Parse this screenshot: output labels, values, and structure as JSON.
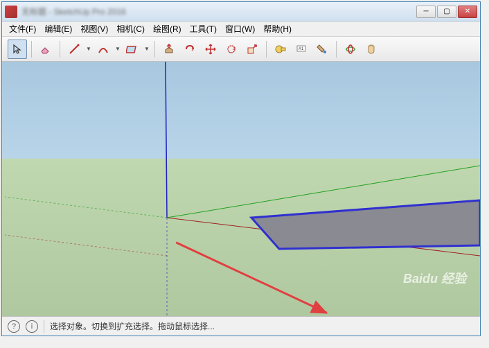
{
  "window": {
    "title": "无标题 - SketchUp Pro 2016"
  },
  "menu": {
    "file": "文件(F)",
    "edit": "编辑(E)",
    "view": "视图(V)",
    "camera": "相机(C)",
    "draw": "绘图(R)",
    "tools": "工具(T)",
    "window": "窗口(W)",
    "help": "帮助(H)"
  },
  "status": {
    "text": "选择对象。切换到扩充选择。拖动鼠标选择..."
  },
  "watermark": "Baidu 经验"
}
